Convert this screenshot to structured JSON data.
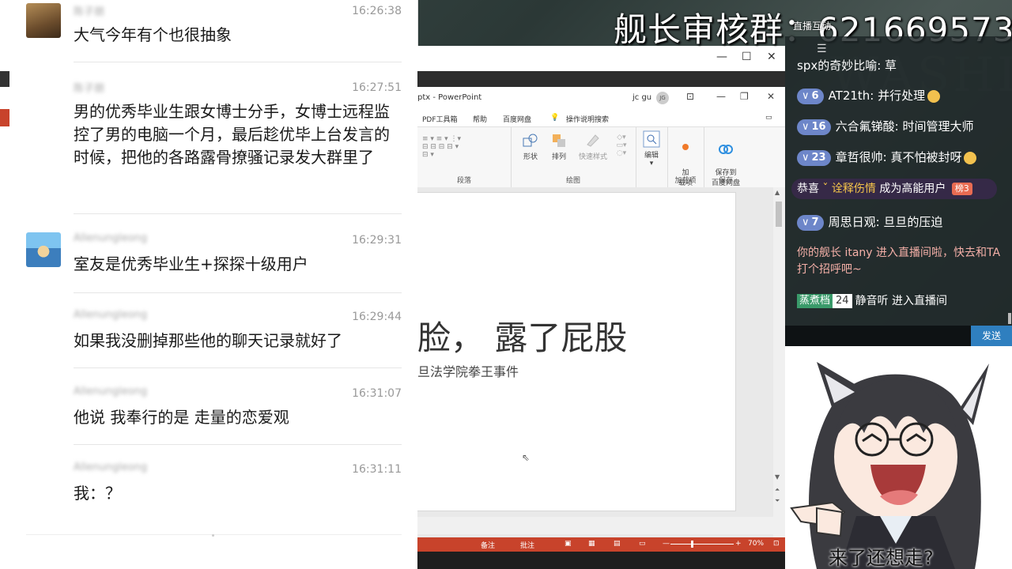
{
  "chat": {
    "messages": [
      {
        "name": "陈子朋",
        "time": "16:26:38",
        "text": "大气今年有个也很抽象",
        "avatar": "dog-photo"
      },
      {
        "name": "陈子朋",
        "time": "16:27:51",
        "text": "男的优秀毕业生跟女博士分手，女博士远程监控了男的电脑一个月，最后趁优毕上台发言的时候，把他的各路露骨撩骚记录发大群里了",
        "avatar": null
      },
      {
        "name": "Allenungleong",
        "time": "16:29:31",
        "text": "室友是优秀毕业生+探探十级用户",
        "avatar": "cartoon-boy"
      },
      {
        "name": "Allenungleong",
        "time": "16:29:44",
        "text": "如果我没删掉那些他的聊天记录就好了",
        "avatar": null
      },
      {
        "name": "Allenungleong",
        "time": "16:31:07",
        "text": "他说 我奉行的是 走量的恋爱观",
        "avatar": null
      },
      {
        "name": "Allenungleong",
        "time": "16:31:11",
        "text": "我：？",
        "avatar": null
      }
    ]
  },
  "ppt": {
    "window_controls": {
      "min": "—",
      "max": "☐",
      "close": "✕"
    },
    "title": "ptx - PowerPoint",
    "user": "jc gu",
    "user_initials": "JG",
    "tabs": [
      "PDF工具箱",
      "帮助",
      "百度网盘",
      "操作说明搜索"
    ],
    "ribbon": {
      "groups": [
        "段落",
        "绘图",
        "加载项",
        "保存"
      ],
      "buttons": {
        "shape": "形状",
        "arrange": "排列",
        "quickstyle": "快速样式",
        "edit": "编辑",
        "load": "加\n载项",
        "save_baidu": "保存到\n百度网盘"
      }
    },
    "slide": {
      "title": "脸，  露了屁股",
      "subtitle": "旦法学院拳王事件"
    },
    "statusbar": {
      "notes": "备注",
      "comments": "批注",
      "zoom": "70%",
      "minus": "—",
      "plus": "+"
    }
  },
  "banner": {
    "title": "舰长审核群：621669573",
    "small": "直播互动"
  },
  "live": {
    "rows": [
      {
        "badge": null,
        "user": "spx的奇妙比喻",
        "text": "草"
      },
      {
        "badge": "6",
        "user": "AT21th",
        "text": "并行处理"
      },
      {
        "badge": "16",
        "user": "六合氟锑酸",
        "text": "时间管理大师"
      },
      {
        "badge": "23",
        "user": "章哲很帅",
        "text": "真不怕被封呀"
      },
      {
        "badge": "7",
        "user": "周思日观",
        "text": "旦旦的压迫"
      }
    ],
    "high_energy": {
      "prefix": "恭喜",
      "user": "诠释伤情",
      "suffix": "成为高能用户",
      "rank": "榜3"
    },
    "system": "你的舰长 itany 进入直播间啦，快去和TA打个招呼吧~",
    "guard_entry": {
      "tag": "蒸煮档",
      "level": "24",
      "user": "静音听",
      "text": "进入直播间"
    },
    "send": "发送"
  },
  "character": {
    "caption": "来了还想走?"
  }
}
